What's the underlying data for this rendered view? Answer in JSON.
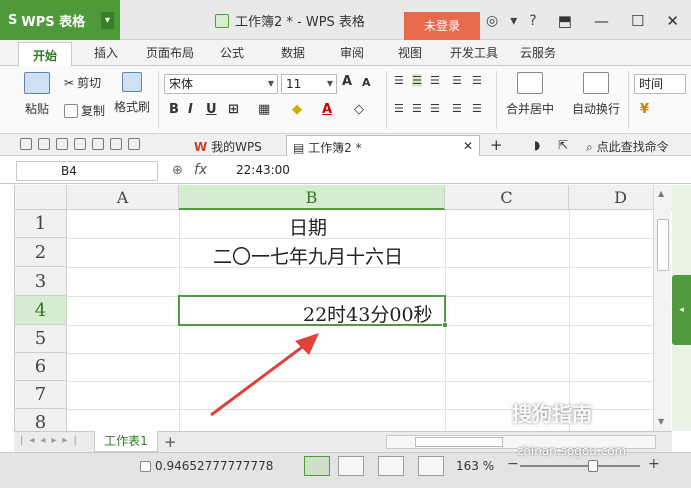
{
  "titlebar": {
    "app_name": "WPS 表格",
    "doc_title": "工作簿2 * - WPS 表格",
    "login_label": "未登录",
    "help_label": "?"
  },
  "menu_tabs": [
    "开始",
    "插入",
    "页面布局",
    "公式",
    "数据",
    "审阅",
    "视图",
    "开发工具",
    "云服务"
  ],
  "ribbon": {
    "paste": "粘贴",
    "cut": "剪切",
    "copy": "复制",
    "format_painter": "格式刷",
    "font_name": "宋体",
    "font_size": "11",
    "merge_center": "合并居中",
    "wrap_text": "自动换行",
    "time": "时间"
  },
  "quick_bar": {
    "tab1": "我的WPS",
    "tab2": "工作簿2 *",
    "search_label": "点此查找命令"
  },
  "formula_bar": {
    "cell_ref": "B4",
    "fx": "fx",
    "formula": "22:43:00"
  },
  "grid": {
    "columns": [
      "A",
      "B",
      "C",
      "D"
    ],
    "rows": [
      "1",
      "2",
      "3",
      "4",
      "5",
      "6",
      "7",
      "8"
    ],
    "cells": {
      "B1": "日期",
      "B2": "二〇一七年九月十六日",
      "B4": "22时43分00秒"
    },
    "selected_cell": "B4"
  },
  "sheet_tabs": {
    "sheet1": "工作表1"
  },
  "status_bar": {
    "value": "0.94652777777778",
    "zoom": "163 %"
  },
  "watermark": {
    "text": "搜狗指南",
    "url": "zhinan.sogou.com"
  },
  "colors": {
    "accent": "#4e9a3a",
    "login": "#e8694c",
    "arrow": "#e0413a"
  }
}
